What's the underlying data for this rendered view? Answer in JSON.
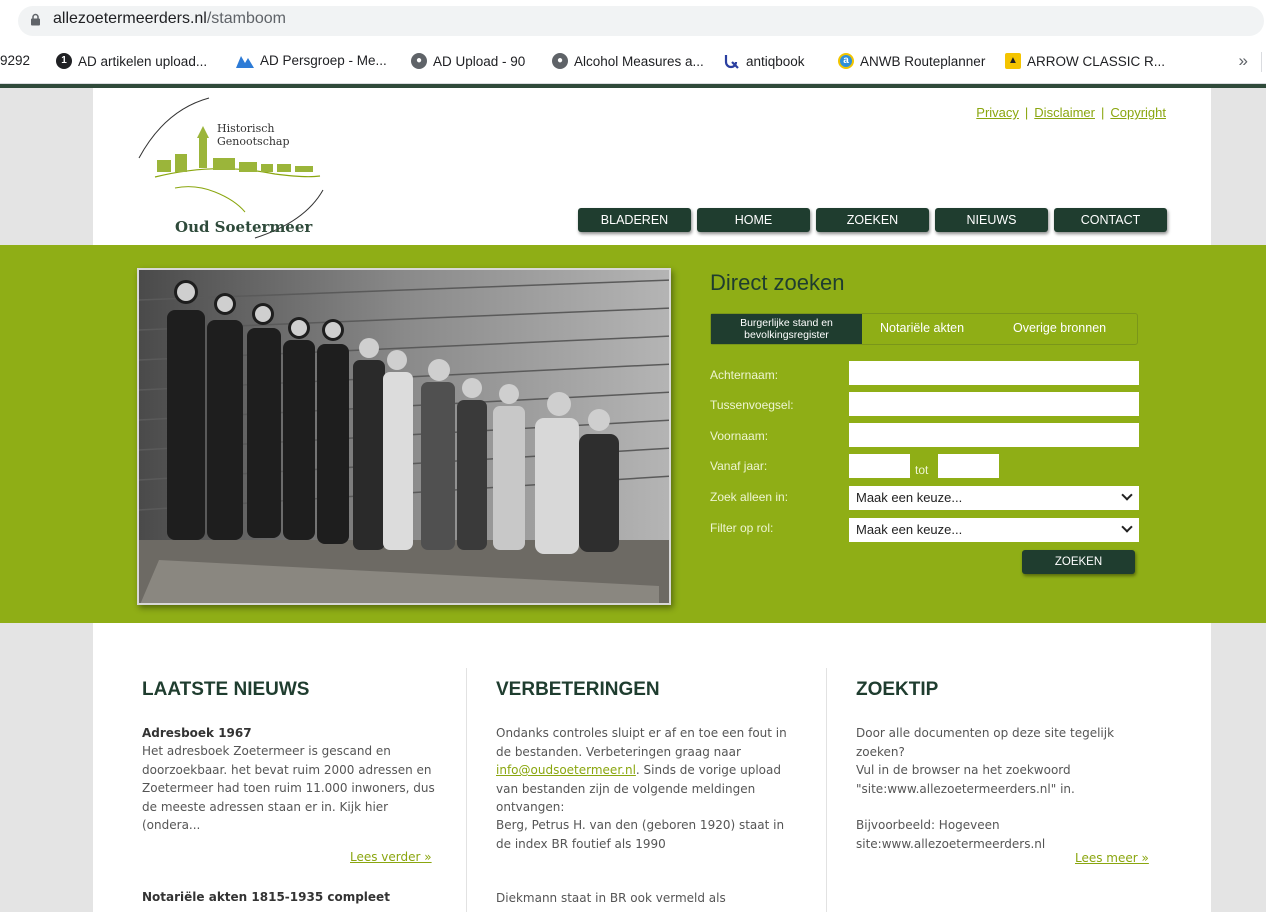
{
  "browser": {
    "url_host": "allezoetermeerders.nl",
    "url_path": "/stamboom",
    "bookmarks": [
      {
        "label": "9292",
        "icon": "none"
      },
      {
        "label": "AD artikelen upload...",
        "icon": "dark-circle-1-icon",
        "badge": "1"
      },
      {
        "label": "AD Persgroep - Me...",
        "icon": "mountain-logo-icon"
      },
      {
        "label": "AD Upload - 90",
        "icon": "globe-icon"
      },
      {
        "label": "Alcohol Measures a...",
        "icon": "globe-icon"
      },
      {
        "label": "antiqbook",
        "icon": "q-logo-icon"
      },
      {
        "label": "ANWB Routeplanner",
        "icon": "anwb-icon"
      },
      {
        "label": "ARROW CLASSIC R...",
        "icon": "arrow-yellow-icon"
      }
    ],
    "more": "»"
  },
  "site": {
    "logo_small": "Historisch Genootschap",
    "logo_big": "Oud Soetermeer",
    "toplinks": [
      "Privacy",
      "Disclaimer",
      "Copyright"
    ],
    "toplinks_sep": "|",
    "nav": [
      "BLADEREN",
      "HOME",
      "ZOEKEN",
      "NIEUWS",
      "CONTACT"
    ]
  },
  "search": {
    "title": "Direct zoeken",
    "tab_active_line1": "Burgerlijke stand en",
    "tab_active_line2": "bevolkingsregister",
    "tabs": [
      "Notariële akten",
      "Overige bronnen"
    ],
    "labels": {
      "achternaam": "Achternaam:",
      "tussenvoegsel": "Tussenvoegsel:",
      "voornaam": "Voornaam:",
      "vanaf": "Vanaf jaar:",
      "tot": "tot",
      "zoek_alleen": "Zoek alleen in:",
      "filter": "Filter op rol:"
    },
    "select_placeholder": "Maak een keuze...",
    "button": "ZOEKEN"
  },
  "news": {
    "title": "LAATSTE NIEUWS",
    "item1_title": "Adresboek 1967",
    "item1_text": "Het adresboek Zoetermeer is gescand en doorzoekbaar. het bevat ruim 2000 adressen en Zoetermeer had toen ruim 11.000 inwoners, dus de meeste adressen staan er in. Kijk hier (ondera...",
    "item1_more": "Lees verder »",
    "item2_title": "Notariële akten 1815-1935 compleet"
  },
  "corrections": {
    "title": "VERBETERINGEN",
    "p1_before": "Ondanks controles sluipt er af en toe een fout in de bestanden. Verbeteringen graag naar ",
    "p1_link": "info@oudsoetermeer.nl",
    "p1_after": ". Sinds de vorige upload van bestanden zijn de volgende meldingen ontvangen:",
    "p2": "Berg, Petrus H. van den (geboren 1920) staat in de index BR foutief als 1990",
    "p3": "Diekmann staat in BR ook vermeld als"
  },
  "tip": {
    "title": "ZOEKTIP",
    "text1": "Door alle documenten op deze site tegelijk zoeken?",
    "text2": "Vul in de browser na het zoekwoord \"site:www.allezoetermeerders.nl\" in.",
    "text3": "Bijvoorbeeld: Hogeveen site:www.allezoetermeerders.nl",
    "more": "Lees meer »"
  },
  "colors": {
    "green": "#8fae16",
    "dark_green": "#1f3d2f",
    "link_green": "#8aa60f"
  }
}
